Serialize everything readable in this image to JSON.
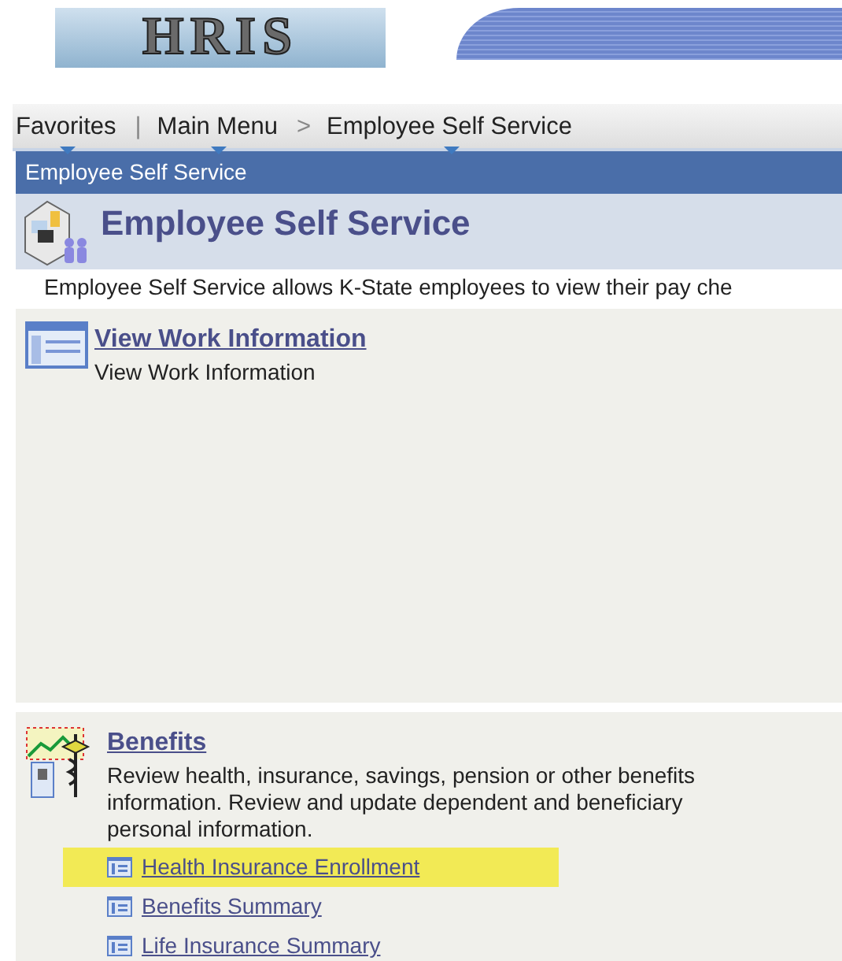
{
  "logo": {
    "text": "HRIS"
  },
  "nav": [
    {
      "label": "Favorites",
      "dropdown": true,
      "separator": "|"
    },
    {
      "label": "Main Menu",
      "dropdown": true,
      "separator": ">"
    },
    {
      "label": "Employee Self Service",
      "dropdown": true
    }
  ],
  "page_header": {
    "bar_title": "Employee Self Service",
    "title": "Employee Self Service",
    "description": "Employee Self Service allows K-State employees to view their pay che"
  },
  "sections": [
    {
      "title": "View Work Information",
      "kind": "window",
      "description": "View Work Information"
    },
    {
      "title": "Benefits",
      "kind": "benefits",
      "description": "Review health, insurance, savings, pension or other benefits information. Review and update dependent and beneficiary personal information.",
      "links": [
        {
          "label": "Health Insurance Enrollment",
          "highlighted": true
        },
        {
          "label": "Benefits Summary",
          "highlighted": false
        },
        {
          "label": "Life Insurance Summary",
          "highlighted": false
        }
      ]
    }
  ]
}
